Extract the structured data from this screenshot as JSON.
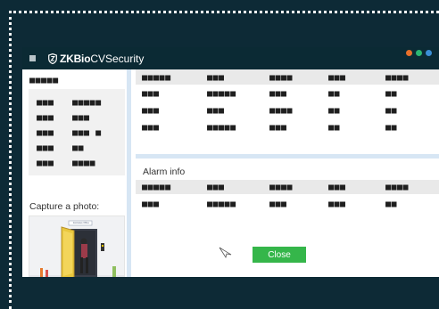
{
  "app": {
    "logo_bold": "ZKBio",
    "logo_light": " CVSecurity",
    "window_dots": [
      "#e8702a",
      "#2bb673",
      "#3b8fd6"
    ]
  },
  "left_panel": {
    "header_mask": "■■■■■",
    "info_rows": [
      {
        "key": "■■■",
        "value": "■■■■■"
      },
      {
        "key": "■■■",
        "value": "■■■"
      },
      {
        "key": "■■■",
        "value": "■■■ ■"
      },
      {
        "key": "■■■",
        "value": "■■"
      },
      {
        "key": "■■■",
        "value": "■■■■"
      }
    ],
    "capture_label": "Capture a photo:",
    "photo_sign": "Exclusive Office"
  },
  "records_table": {
    "headers": [
      "■■■■■",
      "■■■",
      "■■■■",
      "■■■",
      "■■■■"
    ],
    "rows": [
      [
        "■■■",
        "■■■■■",
        "■■■",
        "■■",
        "■■"
      ],
      [
        "■■■",
        "■■■",
        "■■■■",
        "■■",
        "■■"
      ],
      [
        "■■■",
        "■■■■■",
        "■■■",
        "■■",
        "■■"
      ]
    ]
  },
  "alarm": {
    "title": "Alarm info",
    "headers": [
      "■■■■■",
      "■■■",
      "■■■■",
      "■■■",
      "■■■■"
    ],
    "rows": [
      [
        "■■■",
        "■■■■■",
        "■■■",
        "■■■",
        "■■"
      ]
    ],
    "close_label": "Close"
  }
}
